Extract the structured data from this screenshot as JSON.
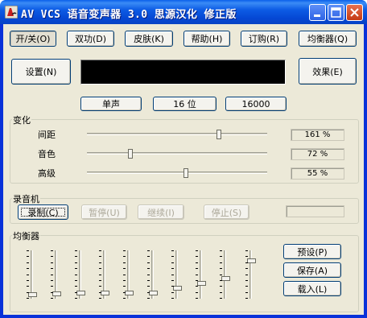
{
  "window": {
    "title": "AV VCS 语音变声器 3.0    思源汉化 修正版",
    "controls": [
      "minimize",
      "maximize",
      "close"
    ]
  },
  "toolbar": {
    "power": "开/关(O)",
    "dual": "双功(D)",
    "skin": "皮肤(K)",
    "help": "帮助(H)",
    "order": "订购(R)",
    "equalizer": "均衡器(Q)"
  },
  "settings_button": "设置(N)",
  "effects_button": "效果(E)",
  "audio_format": {
    "channels": "单声",
    "bits": "16 位",
    "rate": "16000"
  },
  "morph": {
    "title": "变化",
    "rows": [
      {
        "label": "间距",
        "value": "161 %",
        "level": 0.73
      },
      {
        "label": "音色",
        "value": "72 %",
        "level": 0.24
      },
      {
        "label": "高级",
        "value": "55 %",
        "level": 0.55
      }
    ]
  },
  "recorder": {
    "title": "录音机",
    "record": "录制(C)",
    "pause": "暂停(U)",
    "resume": "继续(I)",
    "stop": "停止(S)",
    "status": ""
  },
  "equalizer": {
    "title": "均衡器",
    "levels": [
      0.08,
      0.1,
      0.12,
      0.12,
      0.12,
      0.12,
      0.22,
      0.32,
      0.42,
      0.78
    ],
    "preset": "预设(P)",
    "save": "保存(A)",
    "load": "载入(L)"
  },
  "colors": {
    "titlebar": "#0548d4",
    "client": "#ece9d8",
    "display": "#000000",
    "close_button": "#c43a14"
  },
  "icons": {
    "app": "app-icon",
    "minimize": "minimize-icon",
    "maximize": "maximize-icon",
    "close": "close-icon"
  }
}
